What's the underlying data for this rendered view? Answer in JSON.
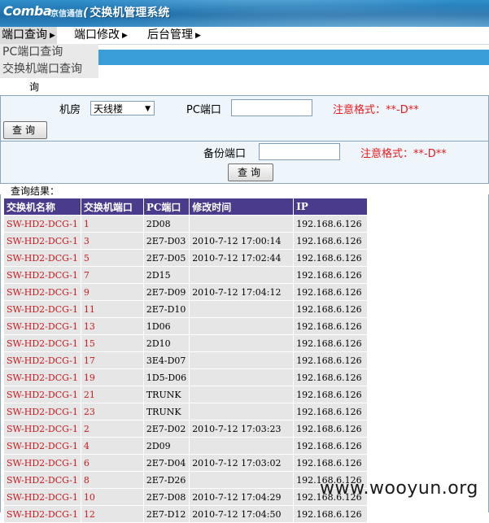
{
  "header": {
    "logo_text": "Comba",
    "logo_cn": "京信通信",
    "system_title": "交换机管理系统"
  },
  "menu": {
    "items": [
      {
        "label": "端口查询"
      },
      {
        "label": "端口修改"
      },
      {
        "label": "后台管理"
      }
    ],
    "dropdown": [
      "PC端口查询",
      "交换机端口查询"
    ]
  },
  "page_fragment": "询",
  "form": {
    "room_label": "机房",
    "room_value": "天线楼",
    "pc_port_label": "PC端口",
    "pc_port_value": "",
    "format_note": "注意格式：**-D**",
    "query_button": "查询",
    "backup_port_label": "备份端口",
    "backup_port_value": "",
    "backup_format_note": "注意格式：**-D**",
    "backup_query_button": "查询"
  },
  "results": {
    "label": "查询结果：",
    "columns": [
      "交换机名称",
      "交换机端口",
      "PC端口",
      "修改时间",
      "IP"
    ],
    "rows": [
      [
        "SW-HD2-DCG-1",
        "1",
        "2D08",
        "",
        "192.168.6.126"
      ],
      [
        "SW-HD2-DCG-1",
        "3",
        "2E7-D03",
        "2010-7-12 17:00:14",
        "192.168.6.126"
      ],
      [
        "SW-HD2-DCG-1",
        "5",
        "2E7-D05",
        "2010-7-12 17:02:44",
        "192.168.6.126"
      ],
      [
        "SW-HD2-DCG-1",
        "7",
        "2D15",
        "",
        "192.168.6.126"
      ],
      [
        "SW-HD2-DCG-1",
        "9",
        "2E7-D09",
        "2010-7-12 17:04:12",
        "192.168.6.126"
      ],
      [
        "SW-HD2-DCG-1",
        "11",
        "2E7-D10",
        "",
        "192.168.6.126"
      ],
      [
        "SW-HD2-DCG-1",
        "13",
        "1D06",
        "",
        "192.168.6.126"
      ],
      [
        "SW-HD2-DCG-1",
        "15",
        "2D10",
        "",
        "192.168.6.126"
      ],
      [
        "SW-HD2-DCG-1",
        "17",
        "3E4-D07",
        "",
        "192.168.6.126"
      ],
      [
        "SW-HD2-DCG-1",
        "19",
        "1D5-D06",
        "",
        "192.168.6.126"
      ],
      [
        "SW-HD2-DCG-1",
        "21",
        "TRUNK",
        "",
        "192.168.6.126"
      ],
      [
        "SW-HD2-DCG-1",
        "23",
        "TRUNK",
        "",
        "192.168.6.126"
      ],
      [
        "SW-HD2-DCG-1",
        "2",
        "2E7-D02",
        "2010-7-12 17:03:23",
        "192.168.6.126"
      ],
      [
        "SW-HD2-DCG-1",
        "4",
        "2D09",
        "",
        "192.168.6.126"
      ],
      [
        "SW-HD2-DCG-1",
        "6",
        "2E7-D04",
        "2010-7-12 17:03:02",
        "192.168.6.126"
      ],
      [
        "SW-HD2-DCG-1",
        "8",
        "2E7-D26",
        "",
        "192.168.6.126"
      ],
      [
        "SW-HD2-DCG-1",
        "10",
        "2E7-D08",
        "2010-7-12 17:04:29",
        "192.168.6.126"
      ],
      [
        "SW-HD2-DCG-1",
        "12",
        "2E7-D12",
        "2010-7-12 17:04:50",
        "192.168.6.126"
      ]
    ]
  },
  "watermark": "www.wooyun.org"
}
